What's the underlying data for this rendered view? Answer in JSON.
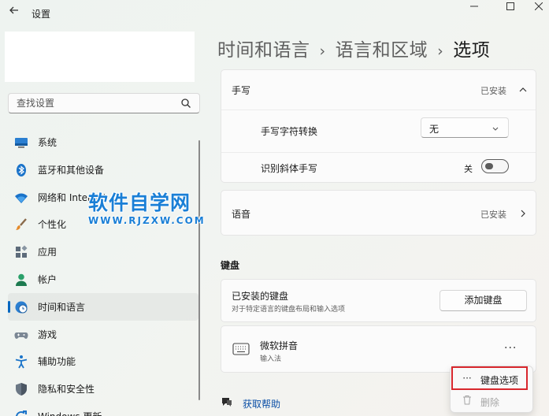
{
  "window": {
    "title": "设置",
    "back_icon": "arrow-left-icon",
    "controls": [
      "minimize-icon",
      "maximize-icon",
      "close-icon"
    ]
  },
  "search": {
    "placeholder": "查找设置",
    "icon": "search-icon"
  },
  "sidebar": {
    "items": [
      {
        "label": "系统",
        "icon": "monitor-icon"
      },
      {
        "label": "蓝牙和其他设备",
        "icon": "bluetooth-icon"
      },
      {
        "label": "网络和 Internet",
        "icon": "wifi-icon"
      },
      {
        "label": "个性化",
        "icon": "brush-icon"
      },
      {
        "label": "应用",
        "icon": "apps-icon"
      },
      {
        "label": "帐户",
        "icon": "person-icon"
      },
      {
        "label": "时间和语言",
        "icon": "globe-clock-icon",
        "active": true
      },
      {
        "label": "游戏",
        "icon": "gamepad-icon"
      },
      {
        "label": "辅助功能",
        "icon": "accessibility-icon"
      },
      {
        "label": "隐私和安全性",
        "icon": "shield-icon"
      },
      {
        "label": "Windows 更新",
        "icon": "update-icon"
      }
    ]
  },
  "breadcrumb": {
    "part1": "时间和语言",
    "part2": "语言和区域",
    "current": "选项"
  },
  "handwriting": {
    "title": "手写",
    "status": "已安装",
    "convert_label": "手写字符转换",
    "convert_value": "无",
    "italic_label": "识别斜体手写",
    "italic_state": "关"
  },
  "speech": {
    "title": "语音",
    "status": "已安装"
  },
  "keyboards": {
    "heading": "键盘",
    "installed_title": "已安装的键盘",
    "installed_desc": "对于特定语言的键盘布局和输入选项",
    "add_button": "添加键盘",
    "item_name": "微软拼音",
    "item_type": "输入法",
    "more_icon": "more-dots-icon"
  },
  "context_menu": {
    "options_label": "键盘选项",
    "remove_label": "删除",
    "highlight_color": "#d8272d"
  },
  "help": {
    "label": "获取帮助"
  },
  "watermark": {
    "main": "软件自学网",
    "sub": "WWW.RJZXW.COM"
  },
  "colors": {
    "accent": "#0067c0",
    "link": "#0b4fa6",
    "watermark": "#1a7fd6"
  }
}
